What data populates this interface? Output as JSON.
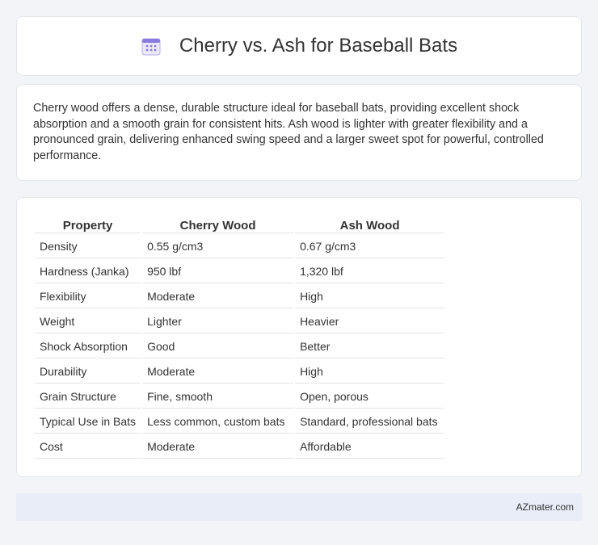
{
  "header": {
    "title": "Cherry vs. Ash for Baseball Bats",
    "icon": "calendar-icon"
  },
  "intro": {
    "text": "Cherry wood offers a dense, durable structure ideal for baseball bats, providing excellent shock absorption and a smooth grain for consistent hits. Ash wood is lighter with greater flexibility and a pronounced grain, delivering enhanced swing speed and a larger sweet spot for powerful, controlled performance."
  },
  "table": {
    "headers": [
      "Property",
      "Cherry Wood",
      "Ash Wood"
    ],
    "rows": [
      [
        "Density",
        "0.55 g/cm3",
        "0.67 g/cm3"
      ],
      [
        "Hardness (Janka)",
        "950 lbf",
        "1,320 lbf"
      ],
      [
        "Flexibility",
        "Moderate",
        "High"
      ],
      [
        "Weight",
        "Lighter",
        "Heavier"
      ],
      [
        "Shock Absorption",
        "Good",
        "Better"
      ],
      [
        "Durability",
        "Moderate",
        "High"
      ],
      [
        "Grain Structure",
        "Fine, smooth",
        "Open, porous"
      ],
      [
        "Typical Use in Bats",
        "Less common, custom bats",
        "Standard, professional bats"
      ],
      [
        "Cost",
        "Moderate",
        "Affordable"
      ]
    ]
  },
  "footer": {
    "text": "AZmater.com"
  },
  "colors": {
    "background": "#f3f4f7",
    "card": "#ffffff",
    "footer_bg": "#e8edf7",
    "icon_accent": "#8a7be0"
  }
}
